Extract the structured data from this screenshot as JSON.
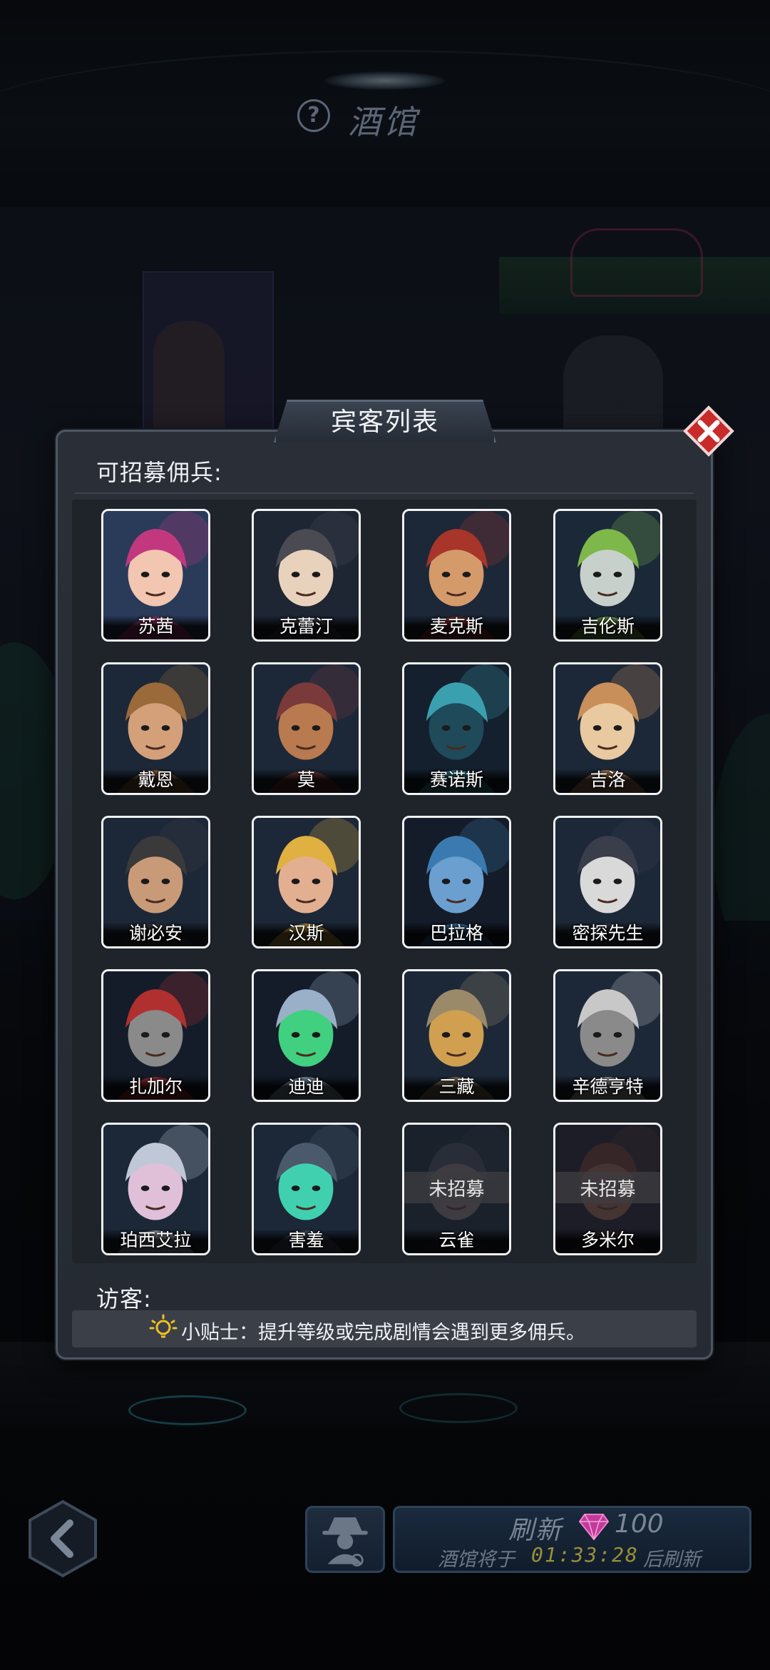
{
  "header": {
    "title": "酒馆",
    "help_icon": "question-mark-icon"
  },
  "dialog": {
    "title": "宾客列表",
    "recruitable_label": "可招募佣兵:",
    "visitors_label": "访客:",
    "tip": "小贴士：提升等级或完成剧情会遇到更多佣兵。",
    "close_icon": "close-x-icon"
  },
  "heroes": [
    {
      "name": "苏茜",
      "status": "",
      "colors": [
        "#c2387f",
        "#f2c6b0",
        "#2a3b5a"
      ]
    },
    {
      "name": "克蕾汀",
      "status": "",
      "colors": [
        "#4a4a52",
        "#e9d2bb",
        "#1e2634"
      ]
    },
    {
      "name": "麦克斯",
      "status": "",
      "colors": [
        "#a8352a",
        "#d59a6a",
        "#1c2838"
      ]
    },
    {
      "name": "吉伦斯",
      "status": "",
      "colors": [
        "#7fb84a",
        "#c8d0cc",
        "#1a2838"
      ]
    },
    {
      "name": "戴恩",
      "status": "",
      "colors": [
        "#9a6a3a",
        "#d4a07a",
        "#1c2838"
      ]
    },
    {
      "name": "莫",
      "status": "",
      "colors": [
        "#7a3a3a",
        "#b87a4e",
        "#1c2838"
      ]
    },
    {
      "name": "赛诺斯",
      "status": "",
      "colors": [
        "#3aa0b0",
        "#1f4a5a",
        "#14202e"
      ]
    },
    {
      "name": "吉洛",
      "status": "",
      "colors": [
        "#c88f5a",
        "#e8c9a0",
        "#1c2838"
      ]
    },
    {
      "name": "谢必安",
      "status": "",
      "colors": [
        "#3a3a3a",
        "#c99a78",
        "#1c2838"
      ]
    },
    {
      "name": "汉斯",
      "status": "",
      "colors": [
        "#e0b040",
        "#e2b090",
        "#1c2838"
      ]
    },
    {
      "name": "巴拉格",
      "status": "",
      "colors": [
        "#3a7ab0",
        "#6a9fd0",
        "#141c2a"
      ]
    },
    {
      "name": "密探先生",
      "status": "",
      "colors": [
        "#3a3d4a",
        "#d9d9d9",
        "#1c2838"
      ]
    },
    {
      "name": "扎加尔",
      "status": "",
      "colors": [
        "#b03030",
        "#8a8a8a",
        "#141c2a"
      ]
    },
    {
      "name": "迪迪",
      "status": "",
      "colors": [
        "#9ab0c8",
        "#40d080",
        "#141c2a"
      ]
    },
    {
      "name": "三藏",
      "status": "",
      "colors": [
        "#9a8a6a",
        "#d0a050",
        "#1c2838"
      ]
    },
    {
      "name": "辛德亨特",
      "status": "",
      "colors": [
        "#c8c8c8",
        "#8a8a8a",
        "#1c2838"
      ]
    },
    {
      "name": "珀西艾拉",
      "status": "",
      "colors": [
        "#c0c8d8",
        "#e0c0d8",
        "#1c2838"
      ]
    },
    {
      "name": "害羞",
      "status": "",
      "colors": [
        "#4a5a6a",
        "#40d0b0",
        "#1c2838"
      ]
    },
    {
      "name": "云雀",
      "status": "未招募",
      "colors": [
        "#3a3a3a",
        "#6a5a50",
        "#1c2020"
      ]
    },
    {
      "name": "多米尔",
      "status": "未招募",
      "colors": [
        "#5a2a1a",
        "#7a4a30",
        "#201818"
      ]
    }
  ],
  "bottom": {
    "refresh_label": "刷新",
    "refresh_cost": "100",
    "countdown_prefix": "酒馆将于",
    "countdown_time": "01:33:28",
    "countdown_suffix": "后刷新",
    "gem_color": "#c43a9a"
  }
}
